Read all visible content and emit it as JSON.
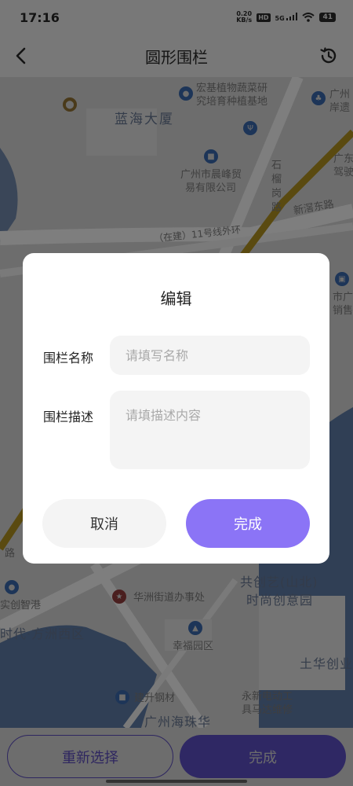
{
  "status_bar": {
    "time": "17:16",
    "net_speed_value": "0.20",
    "net_speed_unit": "KB/s",
    "hd": "HD",
    "signal": "5G",
    "battery": "41"
  },
  "header": {
    "title": "圆形围栏",
    "back_icon": "chevron-left-icon",
    "history_icon": "history-clock-icon"
  },
  "map": {
    "labels": {
      "guangzhou_ruins": "广州",
      "guangzhou_ruins2": "岸遗",
      "research_1": "宏基植物蔬菜研",
      "research_2": "究培育种植基地",
      "lanhai": "蓝海大厦",
      "chenfeng_1": "广州市晨峰贸",
      "chenfeng_2": "易有限公司",
      "shiliugang": "石榴岗路",
      "guangdong_drive_1": "广东",
      "guangdong_drive_2": "驾驶",
      "xinjiao_road": "新滘东路",
      "metro_line": "（在建）11号线外环",
      "city_sales_1": "市广",
      "city_sales_2": "销售",
      "road_suffix": "路",
      "chuangzhi": "实创智港",
      "huazhou_office": "华洲街道办事处",
      "gongchuang_1": "共创艺(山北)",
      "gongchuang_2": "时尚创意园",
      "fangzhou_west": "时代·方洲西区",
      "xingfu": "幸福园区",
      "tuhua": "土华创业",
      "jiansheng": "建升钢材",
      "yongxin_1": "永新电动工",
      "yongxin_2": "具马达维修",
      "haizhu": "广州海珠华"
    }
  },
  "dialog": {
    "title": "编辑",
    "name_label": "围栏名称",
    "name_placeholder": "请填写名称",
    "name_value": "",
    "desc_label": "围栏描述",
    "desc_placeholder": "请填描述内容",
    "desc_value": "",
    "cancel_label": "取消",
    "done_label": "完成"
  },
  "bottom_bar": {
    "reselect_label": "重新选择",
    "done_label": "完成"
  },
  "colors": {
    "accent": "#8b74f6",
    "overlay_bg": "#6d6d6d",
    "input_bg": "#f4f4f4"
  }
}
